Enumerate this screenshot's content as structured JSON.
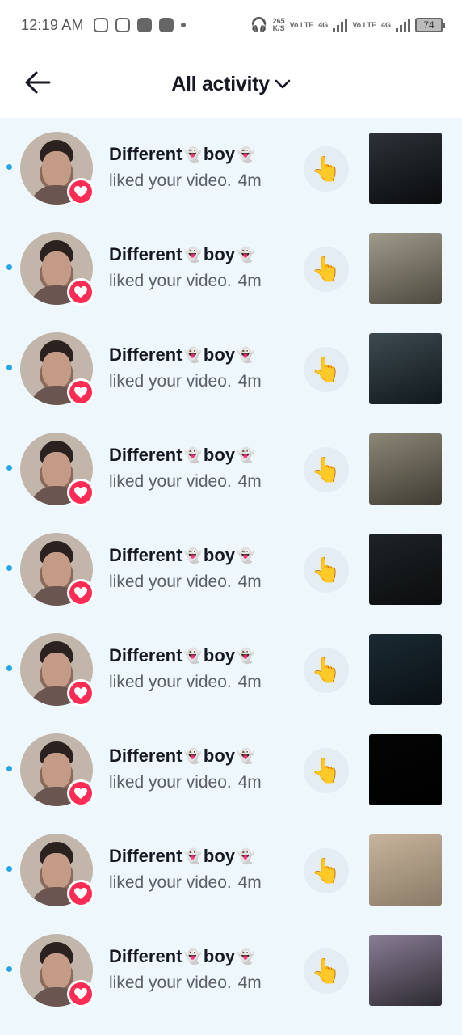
{
  "status_bar": {
    "time": "12:19 AM",
    "net_speed": "265",
    "net_unit": "K/S",
    "sim1_label": "Vo LTE",
    "sim1_type": "4G",
    "sim2_label": "Vo LTE",
    "sim2_type": "4G",
    "battery": "74"
  },
  "header": {
    "title": "All activity"
  },
  "notifications": [
    {
      "name_a": "Different",
      "name_b": "boy",
      "ghost": "👻",
      "desc": "liked your video.",
      "time": "4m",
      "like_emoji": "👆",
      "thumb_colors": [
        "#2c3238",
        "#0a0c0e"
      ]
    },
    {
      "name_a": "Different",
      "name_b": "boy",
      "ghost": "👻",
      "desc": "liked your video.",
      "time": "4m",
      "like_emoji": "👆",
      "thumb_colors": [
        "#a09a8c",
        "#4e4a3f"
      ]
    },
    {
      "name_a": "Different",
      "name_b": "boy",
      "ghost": "👻",
      "desc": "liked your video.",
      "time": "4m",
      "like_emoji": "👆",
      "thumb_colors": [
        "#3d4a50",
        "#10181c"
      ]
    },
    {
      "name_a": "Different",
      "name_b": "boy",
      "ghost": "👻",
      "desc": "liked your video.",
      "time": "4m",
      "like_emoji": "👆",
      "thumb_colors": [
        "#8c8676",
        "#3f3c33"
      ]
    },
    {
      "name_a": "Different",
      "name_b": "boy",
      "ghost": "👻",
      "desc": "liked your video.",
      "time": "4m",
      "like_emoji": "👆",
      "thumb_colors": [
        "#1e2326",
        "#0b0d0e"
      ]
    },
    {
      "name_a": "Different",
      "name_b": "boy",
      "ghost": "👻",
      "desc": "liked your video.",
      "time": "4m",
      "like_emoji": "👆",
      "thumb_colors": [
        "#1a2a33",
        "#0a1014"
      ]
    },
    {
      "name_a": "Different",
      "name_b": "boy",
      "ghost": "👻",
      "desc": "liked your video.",
      "time": "4m",
      "like_emoji": "👆",
      "thumb_colors": [
        "#050505",
        "#000000"
      ]
    },
    {
      "name_a": "Different",
      "name_b": "boy",
      "ghost": "👻",
      "desc": "liked your video.",
      "time": "4m",
      "like_emoji": "👆",
      "thumb_colors": [
        "#c7b49c",
        "#8a7a66"
      ]
    },
    {
      "name_a": "Different",
      "name_b": "boy",
      "ghost": "👻",
      "desc": "liked your video.",
      "time": "4m",
      "like_emoji": "👆",
      "thumb_colors": [
        "#8a7d96",
        "#2c2a30"
      ]
    }
  ],
  "colors": {
    "accent": "#fe2c55",
    "unread_dot": "#28a5e6",
    "list_background": "#eef7fc"
  },
  "icons": {
    "back": "arrow-left-icon",
    "title_dropdown": "chevron-down-icon",
    "badge": "heart-icon"
  }
}
